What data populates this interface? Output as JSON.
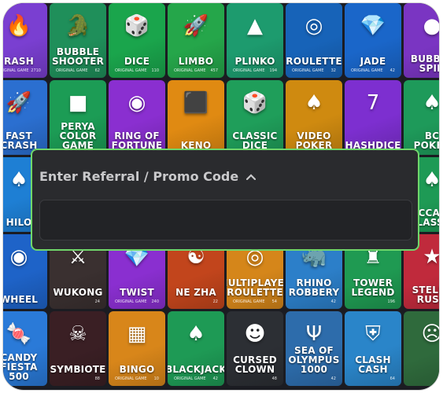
{
  "promo": {
    "title": "Enter Referral / Promo Code",
    "input_value": "",
    "input_placeholder": ""
  },
  "colors": {
    "panel_border": "#6fd66a",
    "panel_bg": "#2a2b2e"
  },
  "tiles": [
    {
      "name": "RASH",
      "badge": "",
      "icon": "flame-icon",
      "color": "#7a3fd1",
      "sub": "ORIGINAL GAME",
      "count": "2710"
    },
    {
      "name": "BUBBLE\nSHOOTER",
      "badge": "",
      "icon": "crocodile-icon",
      "color": "#1f8f5a",
      "sub": "ORIGINAL GAME",
      "count": "62"
    },
    {
      "name": "DICE",
      "badge": "",
      "icon": "dice-icon",
      "color": "#1aa54c",
      "sub": "ORIGINAL GAME",
      "count": "110"
    },
    {
      "name": "LIMBO",
      "badge": "",
      "icon": "rocket-icon",
      "color": "#25a64a",
      "sub": "ORIGINAL GAME",
      "count": "457"
    },
    {
      "name": "PLINKO",
      "badge": "",
      "icon": "pyramid-icon",
      "color": "#1d9b6e",
      "sub": "ORIGINAL GAME",
      "count": "194"
    },
    {
      "name": "ROULETTE",
      "badge": "",
      "icon": "roulette-icon",
      "color": "#1763b8",
      "sub": "ORIGINAL GAME",
      "count": "32"
    },
    {
      "name": "JADE",
      "badge": "",
      "icon": "gem-icon",
      "color": "#1a66c9",
      "sub": "ORIGINAL GAME",
      "count": "42"
    },
    {
      "name": "BUBBLE\nSPIN",
      "badge": "",
      "icon": "bubble-icon",
      "color": "#7a35c2",
      "sub": "",
      "count": ""
    },
    {
      "name": "FAST\nCRASH",
      "badge": "",
      "icon": "rocket-icon",
      "color": "#2b6fd0",
      "sub": "",
      "count": ""
    },
    {
      "name": "PERYA\nCOLOR GAME",
      "badge": "",
      "icon": "cubes-icon",
      "color": "#1c9c55",
      "sub": "",
      "count": ""
    },
    {
      "name": "RING OF\nFORTUNE",
      "badge": "",
      "icon": "wheel-icon",
      "color": "#8a2fd0",
      "sub": "",
      "count": ""
    },
    {
      "name": "KENO",
      "badge": "",
      "icon": "number-icon",
      "color": "#e08a12",
      "sub": "",
      "count": ""
    },
    {
      "name": "CLASSIC\nDICE",
      "badge": "",
      "icon": "dice-icon",
      "color": "#1f9e5a",
      "sub": "",
      "count": ""
    },
    {
      "name": "VIDEO\nPOKER",
      "badge": "",
      "icon": "cards-icon",
      "color": "#cf8a10",
      "sub": "",
      "count": ""
    },
    {
      "name": "HASHDICE",
      "badge": "",
      "icon": "slot-icon",
      "color": "#7d2fd0",
      "sub": "",
      "count": ""
    },
    {
      "name": "BC\nPOKER",
      "badge": "",
      "icon": "cards-icon",
      "color": "#1e9a5a",
      "sub": "",
      "count": ""
    },
    {
      "name": "HILO",
      "badge": "",
      "icon": "cards-icon",
      "color": "#1e7fd4",
      "sub": "",
      "count": ""
    },
    {
      "name": "",
      "badge": "",
      "icon": "",
      "color": "#1b8f4d",
      "sub": "",
      "count": ""
    },
    {
      "name": "",
      "badge": "",
      "icon": "",
      "color": "#7a2fc8",
      "sub": "",
      "count": ""
    },
    {
      "name": "",
      "badge": "",
      "icon": "",
      "color": "#d88418",
      "sub": "",
      "count": ""
    },
    {
      "name": "",
      "badge": "",
      "icon": "",
      "color": "#1f9a52",
      "sub": "",
      "count": ""
    },
    {
      "name": "",
      "badge": "",
      "icon": "",
      "color": "#d5871a",
      "sub": "",
      "count": ""
    },
    {
      "name": "",
      "badge": "",
      "icon": "",
      "color": "#7a2fc8",
      "sub": "",
      "count": ""
    },
    {
      "name": "BACCARAT\nCLASSIC",
      "badge": "",
      "icon": "cards-icon",
      "color": "#1e9a55",
      "sub": "",
      "count": ""
    },
    {
      "name": "WHEEL",
      "badge": "",
      "icon": "wheel-icon",
      "color": "#1e63c8",
      "sub": "",
      "count": ""
    },
    {
      "name": "WUKONG",
      "badge": "",
      "icon": "warrior-icon",
      "color": "#3a3030",
      "sub": "",
      "count": "24"
    },
    {
      "name": "TWIST",
      "badge": "",
      "icon": "gem-icon",
      "color": "#8a2fd0",
      "sub": "ORIGINAL GAME",
      "count": "240"
    },
    {
      "name": "NE ZHA",
      "badge": "",
      "icon": "hero-icon",
      "color": "#c2451c",
      "sub": "",
      "count": "22"
    },
    {
      "name": "MULTIPLAYER\nROULETTE",
      "badge": "",
      "icon": "roulette-icon",
      "color": "#d5861a",
      "sub": "ORIGINAL GAME",
      "count": "54"
    },
    {
      "name": "RHINO\nROBBERY",
      "badge": "",
      "icon": "rhino-icon",
      "color": "#2c7fc9",
      "sub": "",
      "count": "42"
    },
    {
      "name": "TOWER\nLEGEND",
      "badge": "",
      "icon": "tower-icon",
      "color": "#1f9a52",
      "sub": "",
      "count": "196"
    },
    {
      "name": "STELLA\nRUSH",
      "badge": "",
      "icon": "star-icon",
      "color": "#c02a3c",
      "sub": "",
      "count": ""
    },
    {
      "name": "CANDY\nFIESTA\n500",
      "badge": "",
      "icon": "candy-icon",
      "color": "#2a7ad8",
      "sub": "",
      "count": ""
    },
    {
      "name": "SYMBIOTE",
      "badge": "",
      "icon": "symbiote-icon",
      "color": "#3a1f24",
      "sub": "",
      "count": "88"
    },
    {
      "name": "BINGO",
      "badge": "",
      "icon": "bingo-icon",
      "color": "#d8861a",
      "sub": "ORIGINAL GAME",
      "count": "10"
    },
    {
      "name": "BLACKJACK",
      "badge": "",
      "icon": "cards-icon",
      "color": "#1e9a55",
      "sub": "ORIGINAL GAME",
      "count": "42"
    },
    {
      "name": "CURSED\nCLOWN",
      "badge": "",
      "icon": "clown-icon",
      "color": "#2c2f34",
      "sub": "",
      "count": "48"
    },
    {
      "name": "SEA OF\nOLYMPUS\n1000",
      "badge": "",
      "icon": "trident-icon",
      "color": "#2d6cab",
      "sub": "",
      "count": "42"
    },
    {
      "name": "CLASH\nCASH",
      "badge": "",
      "icon": "shield-icon",
      "color": "#2a85c9",
      "sub": "",
      "count": "64"
    },
    {
      "name": "",
      "badge": "",
      "icon": "zombie-icon",
      "color": "#2f6a3c",
      "sub": "",
      "count": ""
    }
  ]
}
